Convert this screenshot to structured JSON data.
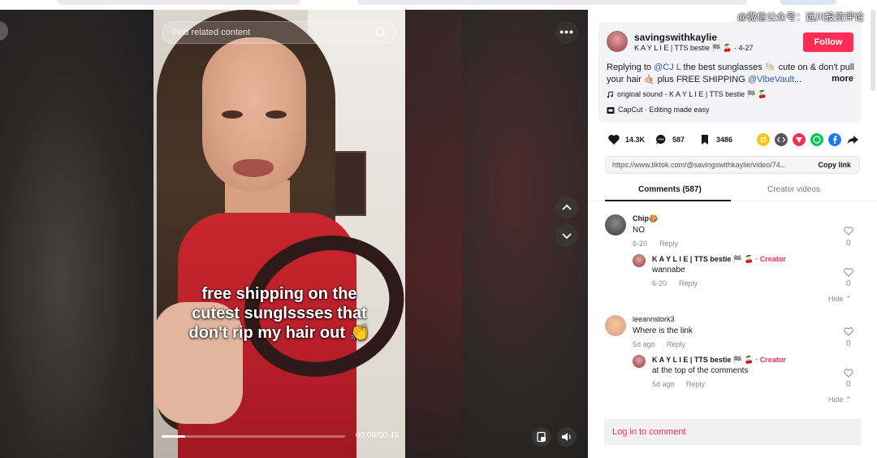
{
  "watermark": "@微信公众号：远川投资评论",
  "video": {
    "search_placeholder": "Find related content",
    "caption_lines": [
      "free shipping on the",
      "cutest sunglssses that",
      "don't rip my hair out 👏"
    ],
    "time": "00:06/00:45",
    "progress": 0.13
  },
  "post": {
    "username": "savingswithkaylie",
    "display_name": "K A Y L I E | TTS bestie 🏁 🍒",
    "date": "4-27",
    "follow_label": "Follow",
    "desc_prefix": "Replying to ",
    "desc_mention": "@CJ L",
    "desc_mid": " the best sunglasses 🐚 cute on & don't pull your hair 🤙🏼 plus FREE SHIPPING ",
    "desc_mention2": "@VibeVault",
    "desc_ellipsis": "...",
    "more_label": "more",
    "music": "original sound - K A Y L I E | TTS bestie 🏁 🍒",
    "capcut": "CapCut · Editing made easy"
  },
  "stats": {
    "likes": "14.3K",
    "comments": "587",
    "saves": "3486"
  },
  "share_colors": [
    "#f5c518",
    "#555555",
    "#fe2c55",
    "#06c755",
    "#1877f2"
  ],
  "link": {
    "url": "https://www.tiktok.com/@savingswithkaylie/video/74...",
    "copy_label": "Copy link"
  },
  "tabs": {
    "comments": "Comments (587)",
    "creator_videos": "Creator videos"
  },
  "comments": [
    {
      "name": "Chip🍪",
      "text": "NO",
      "date": "6-20",
      "reply": "Reply",
      "likes": "0",
      "replies": [
        {
          "name": "K A Y L I E | TTS bestie 🏁 🍒",
          "creator": "· Creator",
          "text": "wannabe",
          "date": "6-20",
          "reply": "Reply",
          "likes": "0"
        }
      ],
      "hide": "Hide ⌃"
    },
    {
      "name": "leeannstork3",
      "text": "Where is the link",
      "date": "5d ago",
      "reply": "Reply",
      "likes": "0",
      "replies": [
        {
          "name": "K A Y L I E | TTS bestie 🏁 🍒",
          "creator": "· Creator",
          "text": "at the top of the comments",
          "date": "5d ago",
          "reply": "Reply",
          "likes": "0"
        }
      ],
      "hide": "Hide ⌃"
    }
  ],
  "login_comment": "Log in to comment"
}
